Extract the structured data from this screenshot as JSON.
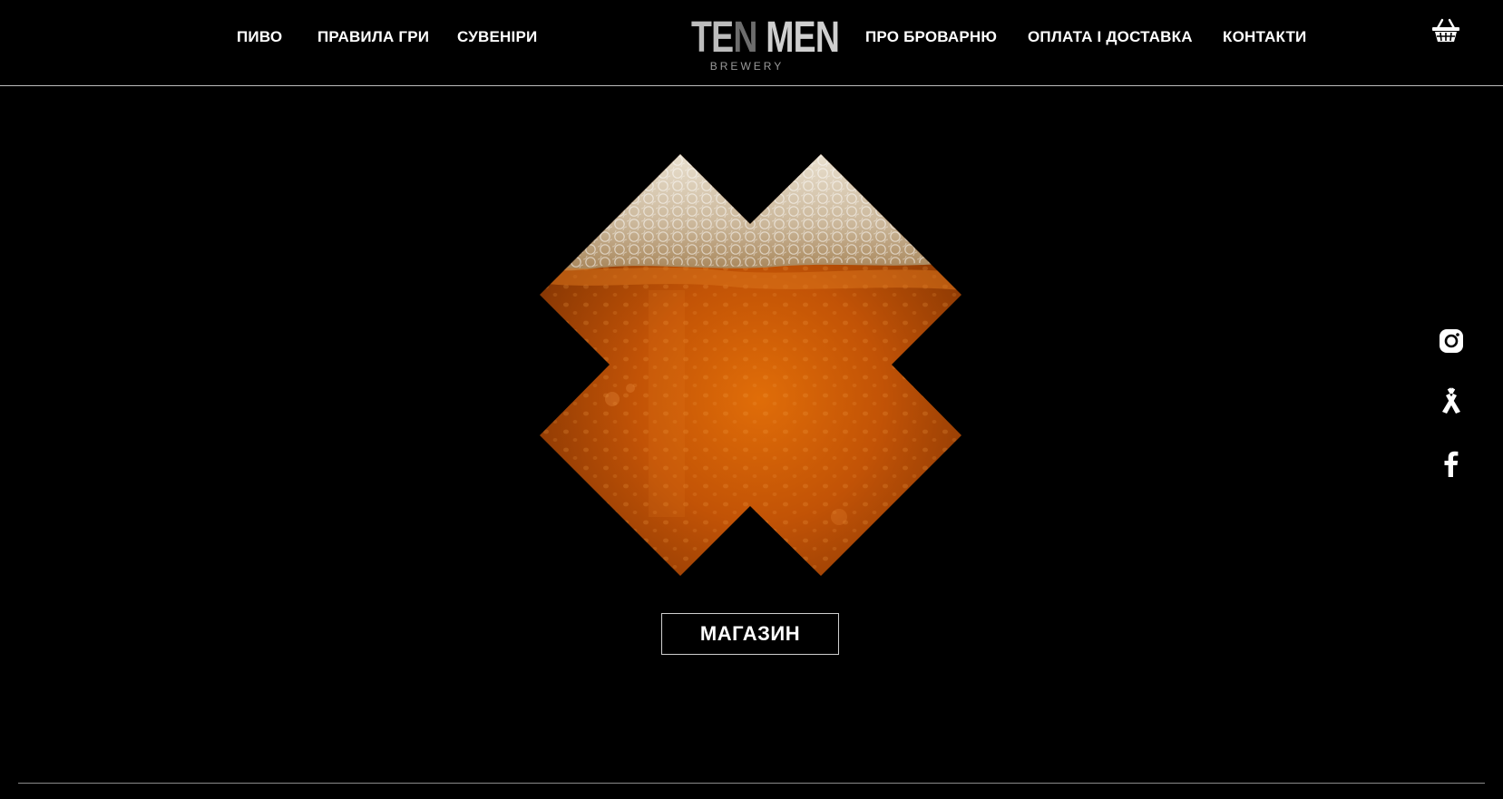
{
  "nav": {
    "left": [
      {
        "label": "ПИВО"
      },
      {
        "label": "ПРАВИЛА ГРИ"
      },
      {
        "label": "СУВЕНІРИ"
      }
    ],
    "right": [
      {
        "label": "ПРО БРОВАРНЮ"
      },
      {
        "label": "ОПЛАТА І ДОСТАВКА"
      },
      {
        "label": "КОНТАКТИ"
      }
    ]
  },
  "logo": {
    "ten": "TE",
    "n": "N",
    "men": " MEN",
    "sub": "BREWERY"
  },
  "cart": {
    "icon": "basket-icon"
  },
  "hero": {
    "shop_label": "МАГАЗИН"
  },
  "social": [
    {
      "icon": "instagram-icon"
    },
    {
      "icon": "untappd-icon"
    },
    {
      "icon": "facebook-icon"
    }
  ],
  "colors": {
    "background": "#000000",
    "text": "#ffffff",
    "beer_amber": "#c85a05",
    "foam": "#d8cbb4"
  }
}
